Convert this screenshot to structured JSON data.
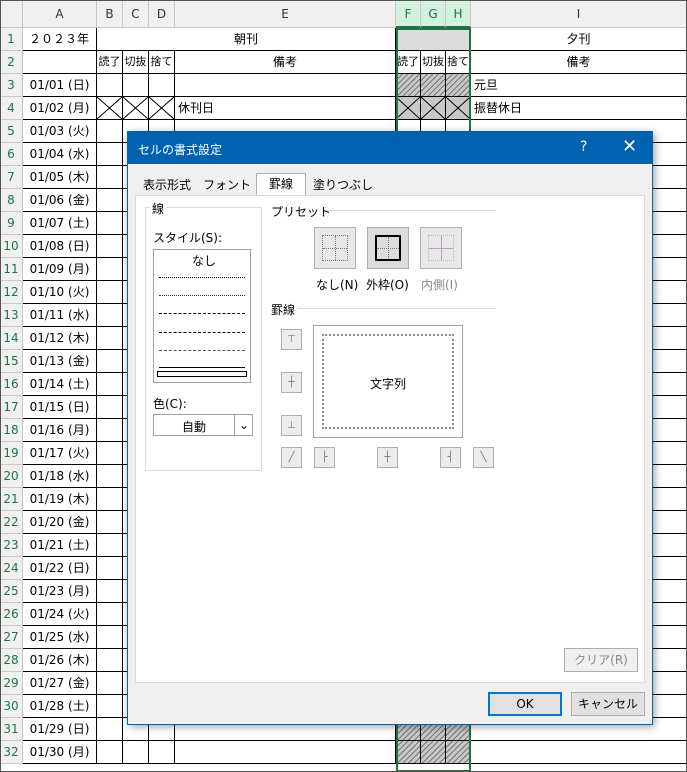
{
  "sheet": {
    "columns": [
      "A",
      "B",
      "C",
      "D",
      "E",
      "F",
      "G",
      "H",
      "I"
    ],
    "selected_columns": [
      "F",
      "G",
      "H"
    ],
    "row1": {
      "A": "２０２３年",
      "morning": "朝刊",
      "evening": "夕刊"
    },
    "row2": {
      "B": "読了",
      "C": "切抜",
      "D": "捨て",
      "E": "備考",
      "F": "読了",
      "G": "切抜",
      "H": "捨て",
      "I": "備考"
    },
    "rows": [
      {
        "num": "3",
        "date": "01/01 (日)",
        "E": "",
        "I": "元旦"
      },
      {
        "num": "4",
        "date": "01/02 (月)",
        "E": "休刊日",
        "I": "振替休日"
      },
      {
        "num": "5",
        "date": "01/03 (火)",
        "E": "",
        "I": ""
      },
      {
        "num": "6",
        "date": "01/04 (水)",
        "E": "",
        "I": ""
      },
      {
        "num": "7",
        "date": "01/05 (木)",
        "E": "",
        "I": ""
      },
      {
        "num": "8",
        "date": "01/06 (金)",
        "E": "",
        "I": ""
      },
      {
        "num": "9",
        "date": "01/07 (土)",
        "E": "",
        "I": ""
      },
      {
        "num": "10",
        "date": "01/08 (日)",
        "E": "",
        "I": ""
      },
      {
        "num": "11",
        "date": "01/09 (月)",
        "E": "",
        "I": ""
      },
      {
        "num": "12",
        "date": "01/10 (火)",
        "E": "",
        "I": ""
      },
      {
        "num": "13",
        "date": "01/11 (水)",
        "E": "",
        "I": ""
      },
      {
        "num": "14",
        "date": "01/12 (木)",
        "E": "",
        "I": ""
      },
      {
        "num": "15",
        "date": "01/13 (金)",
        "E": "",
        "I": ""
      },
      {
        "num": "16",
        "date": "01/14 (土)",
        "E": "",
        "I": ""
      },
      {
        "num": "17",
        "date": "01/15 (日)",
        "E": "",
        "I": ""
      },
      {
        "num": "18",
        "date": "01/16 (月)",
        "E": "",
        "I": ""
      },
      {
        "num": "19",
        "date": "01/17 (火)",
        "E": "",
        "I": ""
      },
      {
        "num": "20",
        "date": "01/18 (水)",
        "E": "",
        "I": ""
      },
      {
        "num": "21",
        "date": "01/19 (木)",
        "E": "",
        "I": ""
      },
      {
        "num": "22",
        "date": "01/20 (金)",
        "E": "",
        "I": ""
      },
      {
        "num": "23",
        "date": "01/21 (土)",
        "E": "",
        "I": ""
      },
      {
        "num": "24",
        "date": "01/22 (日)",
        "E": "",
        "I": ""
      },
      {
        "num": "25",
        "date": "01/23 (月)",
        "E": "",
        "I": ""
      },
      {
        "num": "26",
        "date": "01/24 (火)",
        "E": "",
        "I": ""
      },
      {
        "num": "27",
        "date": "01/25 (水)",
        "E": "",
        "I": ""
      },
      {
        "num": "28",
        "date": "01/26 (木)",
        "E": "",
        "I": ""
      },
      {
        "num": "29",
        "date": "01/27 (金)",
        "E": "",
        "I": ""
      },
      {
        "num": "30",
        "date": "01/28 (土)",
        "E": "",
        "I": ""
      },
      {
        "num": "31",
        "date": "01/29 (日)",
        "E": "",
        "I": ""
      },
      {
        "num": "32",
        "date": "01/30 (月)",
        "E": "",
        "I": ""
      }
    ],
    "colors": {
      "header_green": "#217346",
      "hatch": "#777777"
    }
  },
  "dialog": {
    "title": "セルの書式設定",
    "help": "?",
    "close": "✕",
    "tabs": [
      "表示形式",
      "フォント",
      "罫線",
      "塗りつぶし"
    ],
    "active_tab": "罫線",
    "line_group": "線",
    "style_label": "スタイル(S):",
    "style_none": "なし",
    "color_label": "色(C):",
    "color_value": "自動",
    "preset_group": "プリセット",
    "presets": [
      "なし(N)",
      "外枠(O)",
      "内側(I)"
    ],
    "border_group": "罫線",
    "preview_text": "文字列",
    "clear_button": "クリア(R)",
    "ok_button": "OK",
    "cancel_button": "キャンセル",
    "accent": "#0063b1"
  }
}
